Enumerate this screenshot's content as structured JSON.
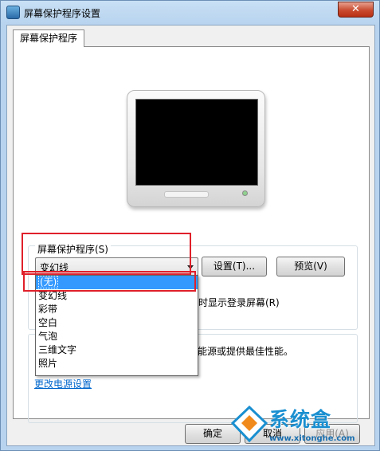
{
  "window": {
    "title": "屏幕保护程序设置",
    "close_label": "✕"
  },
  "tab": {
    "label": "屏幕保护程序"
  },
  "screensaver": {
    "group_label": "屏幕保护程序(S)",
    "selected": "变幻线",
    "settings_label": "设置(T)...",
    "preview_label": "预览(V)",
    "dropdown_items": [
      "(无)",
      "变幻线",
      "彩带",
      "空白",
      "气泡",
      "三维文字",
      "照片"
    ],
    "highlighted_index": 0,
    "wait_text": "恢复时显示登录屏幕(R)"
  },
  "power": {
    "text": "节省能源或提供最佳性能。",
    "link": "更改电源设置"
  },
  "footer": {
    "ok_label": "确定",
    "cancel_label": "取消",
    "apply_label": "应用(A)"
  },
  "watermark": {
    "brand": "系统盒",
    "url": "www.xitonghe.com"
  },
  "colors": {
    "selection": "#3399ff",
    "annotation": "#e0202a",
    "link": "#0066cc"
  }
}
